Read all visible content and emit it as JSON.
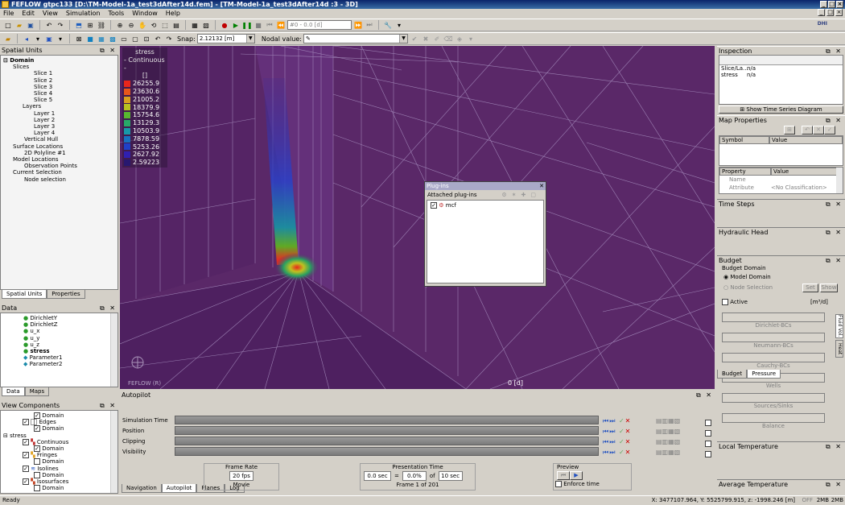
{
  "window": {
    "title": "FEFLOW gtpc133 [D:\\TM-Model-1a_test3dAfter14d.fem] - [TM-Model-1a_test3dAfter14d :3 - 3D]"
  },
  "menu": [
    "File",
    "Edit",
    "View",
    "Simulation",
    "Tools",
    "Window",
    "Help"
  ],
  "toolbar1": {
    "time_value": "#0 - 0.0 [d]"
  },
  "toolbar2": {
    "snap_label": "Snap:",
    "snap_value": "2.12132 [m]",
    "nodal_label": "Nodal value:"
  },
  "spatial_units": {
    "title": "Spatial Units",
    "tree": [
      "Domain",
      "Slices",
      "Slice 1",
      "Slice 2",
      "Slice 3",
      "Slice 4",
      "Slice 5",
      "Layers",
      "Layer 1",
      "Layer 2",
      "Layer 3",
      "Layer 4",
      "Vertical Hull",
      "Surface Locations",
      "2D Polyline #1",
      "Model Locations",
      "Observation Points",
      "Current Selection",
      "Node selection"
    ],
    "tabs": [
      "Spatial Units",
      "Properties"
    ]
  },
  "data_panel": {
    "title": "Data",
    "items": [
      "DirichletY",
      "DirichletZ",
      "u_x",
      "u_y",
      "u_z",
      "stress",
      "Parameter1",
      "Parameter2"
    ],
    "tabs": [
      "Data",
      "Maps"
    ]
  },
  "view_components": {
    "title": "View Components",
    "items": [
      "Domain",
      "Edges",
      "Domain",
      "stress",
      "Continuous",
      "Domain",
      "Fringes",
      "Domain",
      "Isolines",
      "Domain",
      "Isosurfaces",
      "Domain"
    ]
  },
  "legend": {
    "title": "stress",
    "subtitle": "- Continuous -",
    "unit": "[]",
    "values": [
      "26255.9",
      "23630.6",
      "21005.2",
      "18379.9",
      "15754.6",
      "13129.3",
      "10503.9",
      "7878.59",
      "5253.26",
      "2627.92",
      "2.59223"
    ],
    "colors": [
      "#e8261b",
      "#e8561b",
      "#d8a020",
      "#b8c020",
      "#58b830",
      "#28a868",
      "#1898a8",
      "#1870c0",
      "#2040c8",
      "#3020b0",
      "#281870"
    ]
  },
  "viewport": {
    "time_label": "0 [d]",
    "brand": "FEFLOW (R)"
  },
  "plugins_dialog": {
    "title": "Plug-ins",
    "attached_label": "Attached plug-ins",
    "plugin": "mcf"
  },
  "inspection": {
    "title": "Inspection",
    "rows": [
      {
        "k": "Slice/La...",
        "v": "n/a"
      },
      {
        "k": "stress",
        "v": "n/a"
      }
    ],
    "button": "Show Time Series Diagram"
  },
  "map_properties": {
    "title": "Map Properties",
    "col_symbol": "Symbol",
    "col_value": "Value",
    "col_property": "Property",
    "col_value2": "Value",
    "rows": [
      {
        "k": "Name",
        "v": ""
      },
      {
        "k": "Attribute",
        "v": "<No Classification>"
      }
    ]
  },
  "time_steps": {
    "title": "Time Steps"
  },
  "hydraulic_head": {
    "title": "Hydraulic Head"
  },
  "budget": {
    "title": "Budget",
    "group": "Budget Domain",
    "opt_model": "Model Domain",
    "opt_node": "Node Selection",
    "set_btn": "Set",
    "show_btn": "Show",
    "active": "Active",
    "unit": "[m³/d]",
    "rows": [
      "Dirichlet-BCs",
      "Neumann-BCs",
      "Cauchy-BCs",
      "Wells",
      "Sources/Sinks",
      "Balance"
    ],
    "side_tabs": [
      "Fluid Vol.",
      "Heat"
    ],
    "tabs": [
      "Budget",
      "Pressure"
    ]
  },
  "local_temperature": {
    "title": "Local Temperature"
  },
  "average_temperature": {
    "title": "Average Temperature"
  },
  "autopilot": {
    "title": "Autopilot",
    "rows": [
      "Simulation Time",
      "Position",
      "Clipping",
      "Visibility"
    ],
    "frame_rate_title": "Frame Rate",
    "frame_rate_value": "20 fps",
    "movie": "Movie",
    "presentation_title": "Presentation Time",
    "pt_start": "0.0 sec",
    "pt_eq": "=",
    "pt_pct": "0.0%",
    "pt_of": "of",
    "pt_total": "10 sec",
    "frame_info": "Frame 1 of 201",
    "preview_title": "Preview",
    "enforce_time": "Enforce time",
    "tabs": [
      "Navigation",
      "Autopilot",
      "Planes",
      "Log"
    ]
  },
  "status": {
    "text": "Ready",
    "coords": "X: 3477107.964, Y: 5525799.915, z: -1998.246 [m]",
    "off": "OFF",
    "mem1": "2MB",
    "mem2": "2MB"
  }
}
